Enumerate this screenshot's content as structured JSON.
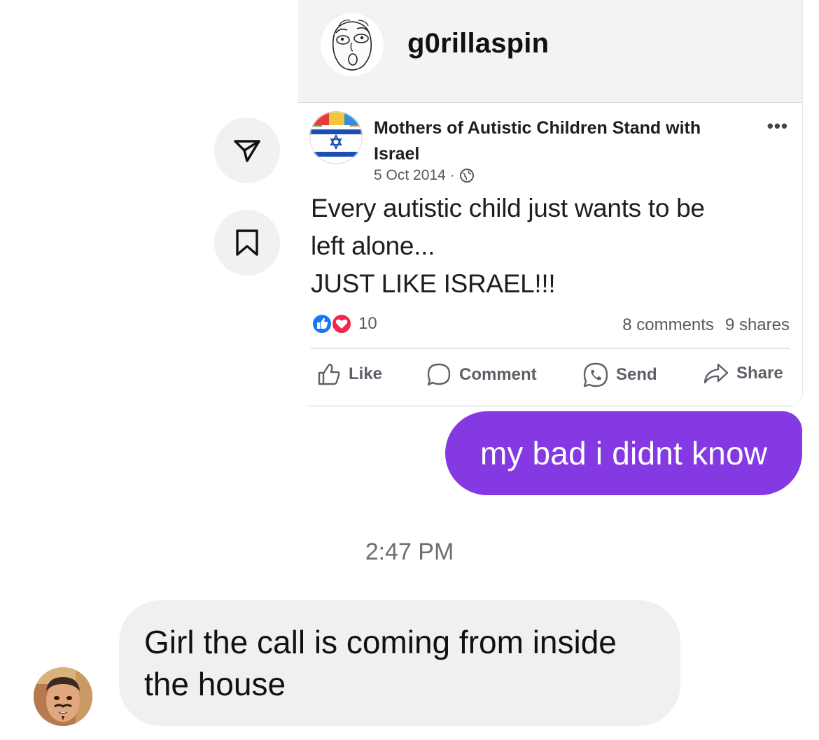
{
  "shared_post": {
    "sender_name": "g0rillaspin",
    "fb_post": {
      "page_name_line1": "Mothers of Autistic Children Stand with",
      "page_name_line2": "Israel",
      "date": "5 Oct 2014",
      "dot": "·",
      "more_label": "•••",
      "text_lines": [
        "Every autistic child just wants to be",
        "left alone...",
        "JUST LIKE ISRAEL!!!"
      ],
      "reaction_count": "10",
      "comments": "8 comments",
      "shares": "9 shares",
      "actions": {
        "like": "Like",
        "comment": "Comment",
        "send": "Send",
        "share": "Share"
      }
    }
  },
  "side_buttons": {
    "forward_icon": "paper-plane-icon",
    "save_icon": "bookmark-icon"
  },
  "messages": {
    "outgoing": "my bad i didnt know",
    "timestamp": "2:47 PM",
    "incoming_line1": "Girl the call is coming from inside",
    "incoming_line2": "the house"
  },
  "colors": {
    "outgoing_bubble": "#8439e2",
    "incoming_bubble": "#f0f0f2",
    "fb_like_blue": "#1877f2",
    "fb_love_red": "#f0284a"
  }
}
